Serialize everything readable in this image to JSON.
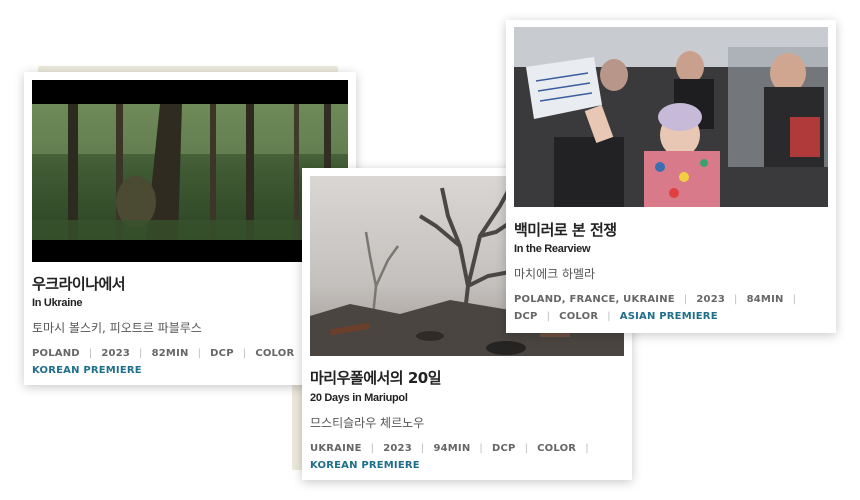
{
  "films": [
    {
      "title_ko": "우크라이나에서",
      "title_en": "In Ukraine",
      "director": "토마시 볼스키, 피오트르 파블루스",
      "meta1": [
        "POLAND",
        "2023",
        "82MIN",
        "DCP",
        "COLOR"
      ],
      "premiere": "KOREAN PREMIERE"
    },
    {
      "title_ko": "마리우폴에서의 20일",
      "title_en": "20 Days in Mariupol",
      "director": "므스티슬라우 체르노우",
      "meta1": [
        "UKRAINE",
        "2023",
        "94MIN",
        "DCP",
        "COLOR"
      ],
      "premiere": "KOREAN PREMIERE"
    },
    {
      "title_ko": "백미러로 본 전쟁",
      "title_en": "In the Rearview",
      "director": "마치에크 하멜라",
      "meta1": [
        "POLAND, FRANCE, UKRAINE",
        "2023",
        "84MIN"
      ],
      "meta2": [
        "DCP",
        "COLOR"
      ],
      "premiere": "ASIAN PREMIERE"
    }
  ],
  "colors": {
    "premiere": "#1f6f8b",
    "meta": "#666666"
  }
}
